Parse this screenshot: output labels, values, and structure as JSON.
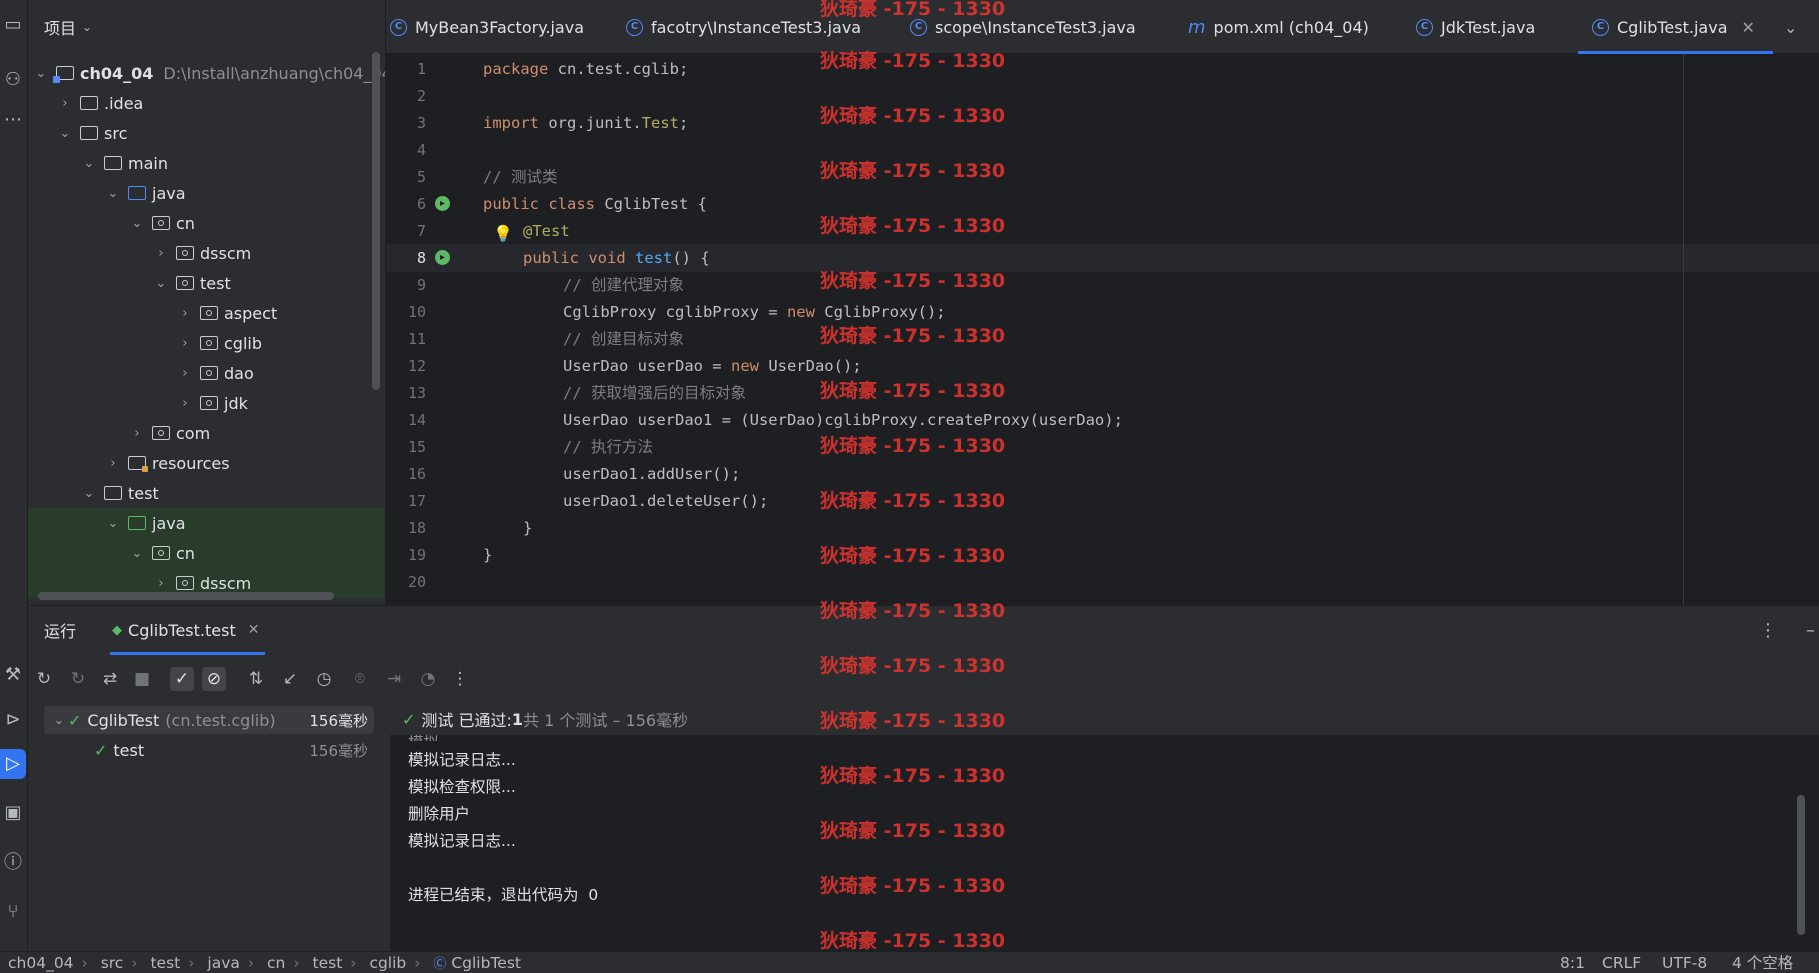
{
  "project_panel": {
    "title": "项目",
    "root_name": "ch04_04",
    "root_path": "D:\\Install\\anzhuang\\ch04_04",
    "items": [
      {
        "label": ".idea"
      },
      {
        "label": "src"
      },
      {
        "label": "main"
      },
      {
        "label": "java"
      },
      {
        "label": "cn"
      },
      {
        "label": "dsscm"
      },
      {
        "label": "test"
      },
      {
        "label": "aspect"
      },
      {
        "label": "cglib"
      },
      {
        "label": "dao"
      },
      {
        "label": "jdk"
      },
      {
        "label": "com"
      },
      {
        "label": "resources"
      },
      {
        "label": "test"
      },
      {
        "label": "java"
      },
      {
        "label": "cn"
      },
      {
        "label": "dsscm"
      }
    ]
  },
  "editor_tabs": [
    {
      "label": "MyBean3Factory.java"
    },
    {
      "label": "facotry\\InstanceTest3.java"
    },
    {
      "label": "scope\\InstanceTest3.java"
    },
    {
      "label": "pom.xml (ch04_04)"
    },
    {
      "label": "JdkTest.java"
    },
    {
      "label": "CglibTest.java"
    }
  ],
  "editor": {
    "line_numbers": [
      "1",
      "2",
      "3",
      "4",
      "5",
      "6",
      "7",
      "8",
      "9",
      "10",
      "11",
      "12",
      "13",
      "14",
      "15",
      "16",
      "17",
      "18",
      "19",
      "20"
    ],
    "lines": {
      "l1_kw": "package",
      "l1_rest": " cn.test.cglib;",
      "l3_kw": "import",
      "l3_rest": " org.junit.",
      "l3_cls": "Test",
      "l3_end": ";",
      "l5": "// 测试类",
      "l6_kw": "public class",
      "l6_rest": " CglibTest {",
      "l7": "@Test",
      "l8_kw": "public void",
      "l8_fn": "test",
      "l8_rest": "() {",
      "l9": "// 创建代理对象",
      "l10_a": "CglibProxy cglibProxy = ",
      "l10_kw": "new",
      "l10_b": " CglibProxy();",
      "l11": "// 创建目标对象",
      "l12_a": "UserDao userDao = ",
      "l12_kw": "new",
      "l12_b": " UserDao();",
      "l13": "// 获取增强后的目标对象",
      "l14": "UserDao userDao1 = (UserDao)cglibProxy.createProxy(userDao);",
      "l15": "// 执行方法",
      "l16": "userDao1.addUser();",
      "l17": "userDao1.deleteUser();",
      "l18": "}",
      "l19": "}"
    }
  },
  "watermark": "狄琦豪 -175 - 1330",
  "run_panel": {
    "tab_run": "运行",
    "tab_config": "CglibTest.test",
    "tree": {
      "root_label": "CglibTest",
      "root_pkg": "(cn.test.cglib)",
      "root_time": "156毫秒",
      "child_label": "test",
      "child_time": "156毫秒"
    },
    "status_prefix": "测试 已通过: ",
    "status_count": "1",
    "status_suffix": "共 1 个测试 – 156毫秒",
    "console": {
      "partial": "模拟...",
      "lines": [
        "模拟记录日志...",
        "模拟检查权限...",
        "删除用户",
        "模拟记录日志...",
        "",
        "进程已结束，退出代码为  0"
      ]
    }
  },
  "status_bar": {
    "breadcrumbs": [
      "ch04_04",
      "src",
      "test",
      "java",
      "cn",
      "test",
      "cglib",
      "CglibTest"
    ],
    "position": "8:1",
    "line_sep": "CRLF",
    "encoding": "UTF-8",
    "indent": "4 个空格"
  },
  "colors": {
    "accent": "#3574f0",
    "pass": "#5fb865",
    "keyword": "#cf8e6d",
    "watermark": "#e0342f"
  }
}
